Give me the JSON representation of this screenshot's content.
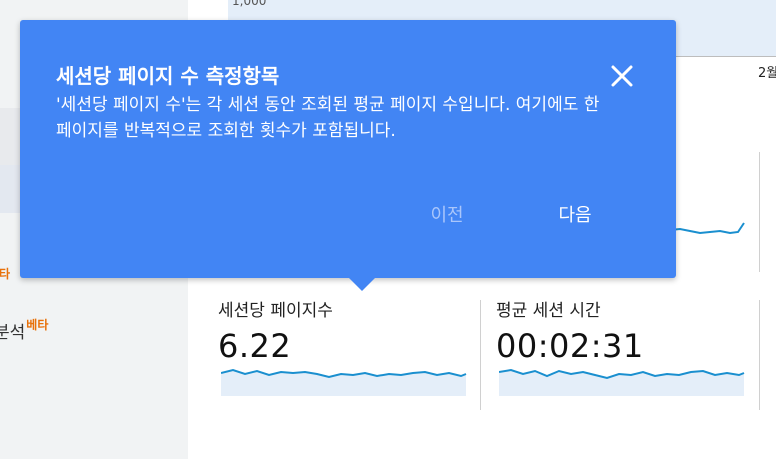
{
  "sidebar": {
    "items": [
      {
        "label": "",
        "beta": ""
      },
      {
        "label": "",
        "beta": ""
      },
      {
        "label": "",
        "beta": "타"
      },
      {
        "label": "분석",
        "beta": "베타"
      }
    ]
  },
  "chart": {
    "y_tick_label": "1,000",
    "x_tick_label": "2월"
  },
  "metrics": [
    {
      "label": "세션당 페이지수",
      "value": "6.22"
    },
    {
      "label": "평균 세션 시간",
      "value": "00:02:31"
    }
  ],
  "popup": {
    "title": "세션당 페이지 수 측정항목",
    "description": "'세션당 페이지 수'는 각 세션 동안 조회된 평균 페이지 수입니다. 여기에도 한 페이지를 반복적으로 조회한 횟수가 포함됩니다.",
    "prev_label": "이전",
    "next_label": "다음",
    "close_icon": "close-icon"
  },
  "colors": {
    "popup_bg": "#4285f4",
    "accent_orange": "#e8710a",
    "sparkline": "#1a8fcf"
  }
}
